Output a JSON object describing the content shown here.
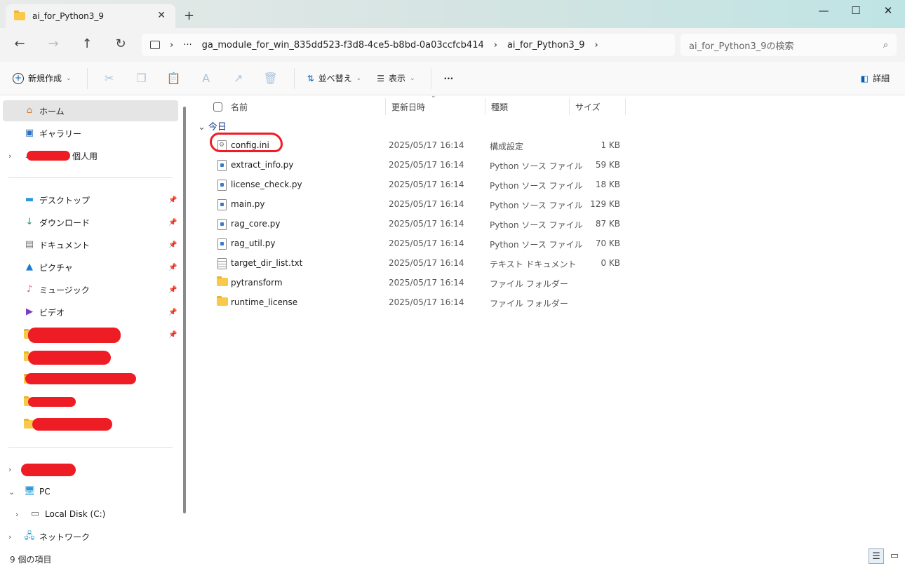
{
  "window": {
    "tab_title": "ai_for_Python3_9",
    "close_tab": "✕",
    "new_tab": "+",
    "minimize": "—",
    "maximize": "☐",
    "close": "✕"
  },
  "nav": {
    "back": "←",
    "forward": "→",
    "up": "↑",
    "refresh": "↻"
  },
  "address": {
    "ellipsis": "···",
    "segments": [
      "ga_module_for_win_835dd523-f3d8-4ce5-b8bd-0a03ccfcb414",
      "ai_for_Python3_9"
    ],
    "separator": "›"
  },
  "search": {
    "placeholder": "ai_for_Python3_9の検索"
  },
  "toolbar": {
    "new": "新規作成",
    "sort": "並べ替え",
    "view": "表示",
    "more": "···",
    "details": "詳細"
  },
  "sidebar": {
    "items": [
      {
        "label": "ホーム",
        "icon": "home-icon"
      },
      {
        "label": "ギャラリー",
        "icon": "gallery-icon"
      },
      {
        "label": "個人用",
        "icon": "cloud-icon"
      },
      {
        "label": "デスクトップ",
        "icon": "desktop-icon"
      },
      {
        "label": "ダウンロード",
        "icon": "download-icon"
      },
      {
        "label": "ドキュメント",
        "icon": "documents-icon"
      },
      {
        "label": "ピクチャ",
        "icon": "pictures-icon"
      },
      {
        "label": "ミュージック",
        "icon": "music-icon"
      },
      {
        "label": "ビデオ",
        "icon": "video-icon"
      },
      {
        "label": "PC",
        "icon": "pc-icon"
      },
      {
        "label": "Local Disk (C:)",
        "icon": "disk-icon"
      },
      {
        "label": "ネットワーク",
        "icon": "network-icon"
      }
    ]
  },
  "columns": {
    "name": "名前",
    "date": "更新日時",
    "type": "種類",
    "size": "サイズ"
  },
  "group": "今日",
  "files": [
    {
      "name": "config.ini",
      "date": "2025/05/17 16:14",
      "type": "構成設定",
      "size": "1 KB",
      "kind": "ini"
    },
    {
      "name": "extract_info.py",
      "date": "2025/05/17 16:14",
      "type": "Python ソース ファイル",
      "size": "59 KB",
      "kind": "py"
    },
    {
      "name": "license_check.py",
      "date": "2025/05/17 16:14",
      "type": "Python ソース ファイル",
      "size": "18 KB",
      "kind": "py"
    },
    {
      "name": "main.py",
      "date": "2025/05/17 16:14",
      "type": "Python ソース ファイル",
      "size": "129 KB",
      "kind": "py"
    },
    {
      "name": "rag_core.py",
      "date": "2025/05/17 16:14",
      "type": "Python ソース ファイル",
      "size": "87 KB",
      "kind": "py"
    },
    {
      "name": "rag_util.py",
      "date": "2025/05/17 16:14",
      "type": "Python ソース ファイル",
      "size": "70 KB",
      "kind": "py"
    },
    {
      "name": "target_dir_list.txt",
      "date": "2025/05/17 16:14",
      "type": "テキスト ドキュメント",
      "size": "0 KB",
      "kind": "txt"
    },
    {
      "name": "pytransform",
      "date": "2025/05/17 16:14",
      "type": "ファイル フォルダー",
      "size": "",
      "kind": "folder"
    },
    {
      "name": "runtime_license",
      "date": "2025/05/17 16:14",
      "type": "ファイル フォルダー",
      "size": "",
      "kind": "folder"
    }
  ],
  "status": {
    "count": "9 個の項目"
  },
  "colors": {
    "annotation": "#ee1c24",
    "accent": "#005fb8"
  }
}
